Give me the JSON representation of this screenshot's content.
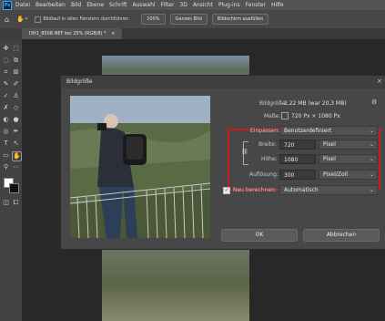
{
  "menu": [
    "Datei",
    "Bearbeiten",
    "Bild",
    "Ebene",
    "Schrift",
    "Auswahl",
    "Filter",
    "3D",
    "Ansicht",
    "Plug-ins",
    "Fenster",
    "Hilfe"
  ],
  "options_bar": {
    "scroll_all_label": "Bildlauf in allen Fenstern durchführen",
    "zoom_label": "100%",
    "fit_screen_label": "Ganzes Bild",
    "fill_screen_label": "Bildschirm ausfüllen"
  },
  "document_tab": {
    "title": "DH1_8508.NEF bei 25% (RGB/8) *",
    "close": "×"
  },
  "dialog": {
    "title": "Bildgröße",
    "close": "×",
    "image_size_label": "Bildgröße:",
    "image_size_value": "2,22 MB (war 20,3 MB)",
    "dimensions_label": "Maße:",
    "dimensions_value": "720 Px × 1080 Px",
    "fit_to_label": "Einpassen:",
    "fit_to_value": "Benutzerdefiniert",
    "width_label": "Breite:",
    "width_value": "720",
    "width_unit": "Pixel",
    "height_label": "Höhe:",
    "height_value": "1080",
    "height_unit": "Pixel",
    "resolution_label": "Auflösung:",
    "resolution_value": "300",
    "resolution_unit": "Pixel/Zoll",
    "resample_label": "Neu berechnen:",
    "resample_value": "Automatisch",
    "resample_checked": true,
    "ok_label": "OK",
    "cancel_label": "Abbrechen"
  },
  "colors": {
    "highlight": "#c41e1e",
    "panel": "#474747",
    "menubar": "#535353"
  }
}
